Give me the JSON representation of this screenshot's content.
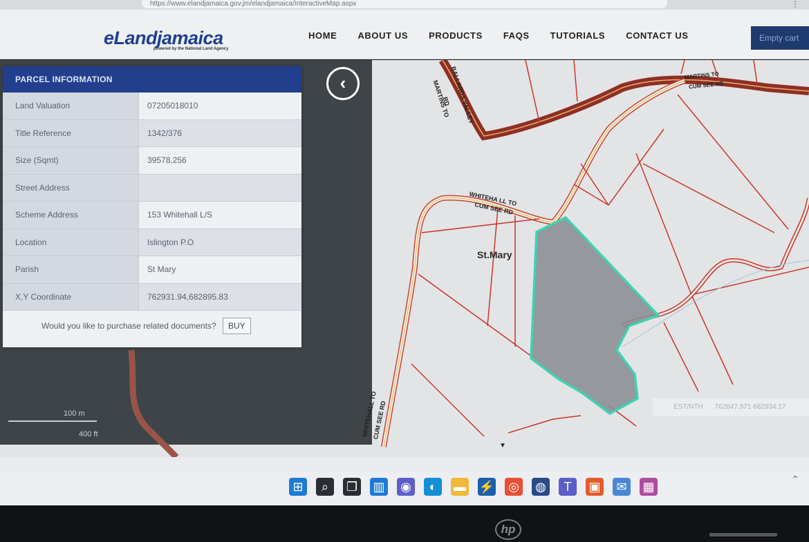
{
  "browser": {
    "url": "https://www.elandjamaica.gov.jm/elandjamaica/InteractiveMap.aspx",
    "menu": "⋮"
  },
  "header": {
    "logo": "eLandjamaica",
    "tagline": "powered by the National Land Agency",
    "nav": [
      "HOME",
      "ABOUT US",
      "PRODUCTS",
      "FAQS",
      "TUTORIALS",
      "CONTACT US"
    ],
    "cart": "Empty cart"
  },
  "panel": {
    "title": "PARCEL INFORMATION",
    "rows": [
      {
        "label": "Land Valuation",
        "value": "07205018010"
      },
      {
        "label": "Title Reference",
        "value": "1342/376"
      },
      {
        "label": "Size (Sqmt)",
        "value": "39578.256"
      },
      {
        "label": "Street Address",
        "value": ""
      },
      {
        "label": "Scheme Address",
        "value": "153 Whitehall L/S"
      },
      {
        "label": "Location",
        "value": "Islington P.O"
      },
      {
        "label": "Parish",
        "value": "St Mary"
      },
      {
        "label": "X,Y Coordinate",
        "value": "762931.94,682895.83"
      }
    ],
    "purchase_prompt": "Would you like to purchase related documents?",
    "buy_label": "BUY"
  },
  "map": {
    "back_icon": "chevron-left-icon",
    "back_glyph": "‹",
    "roads": {
      "martins": "MARTINS TO",
      "ballards": "BALLARDS VALLEY",
      "rd1": "RD",
      "whitehall": "WHITEHA LL TO",
      "cumsee": "CUM SEE RD",
      "whitehall_vert": "WHITEHALL TO",
      "cumsee_vert": "CUM SEE RD",
      "topright1": "MARTINS TO",
      "topright2": "CUM SEE RD"
    },
    "parish_label": "St.Mary",
    "scale": {
      "metric": "100 m",
      "imperial": "400 ft"
    },
    "coords": {
      "label": "EST/NTH",
      "value": "762647.971 682934.17"
    },
    "caret": "▼"
  },
  "taskbar": {
    "icons": [
      {
        "name": "windows-start-icon",
        "glyph": "⊞",
        "color": "#1f7ad6"
      },
      {
        "name": "search-icon",
        "glyph": "⌕",
        "color": "#2a2d33"
      },
      {
        "name": "task-view-icon",
        "glyph": "❐",
        "color": "#2a2d33"
      },
      {
        "name": "widgets-icon",
        "glyph": "▥",
        "color": "#1f7ad6"
      },
      {
        "name": "chat-icon",
        "glyph": "◉",
        "color": "#5b5fc7"
      },
      {
        "name": "edge-icon",
        "glyph": "◐",
        "color": "#138fd6"
      },
      {
        "name": "file-explorer-icon",
        "glyph": "▬",
        "color": "#f1b93a"
      },
      {
        "name": "power-automate-icon",
        "glyph": "⚡",
        "color": "#1b5fae"
      },
      {
        "name": "chrome-icon",
        "glyph": "◎",
        "color": "#e94f33"
      },
      {
        "name": "app-icon",
        "glyph": "◍",
        "color": "#2a4c86"
      },
      {
        "name": "teams-icon",
        "glyph": "T",
        "color": "#5b5fc7"
      },
      {
        "name": "office-icon",
        "glyph": "▣",
        "color": "#e25c2c"
      },
      {
        "name": "mail-icon",
        "glyph": "✉",
        "color": "#4a86d6"
      },
      {
        "name": "store-icon",
        "glyph": "▦",
        "color": "#b04ca0"
      }
    ],
    "tray_glyph": "⌃"
  },
  "bezel": {
    "brand": "hp"
  }
}
